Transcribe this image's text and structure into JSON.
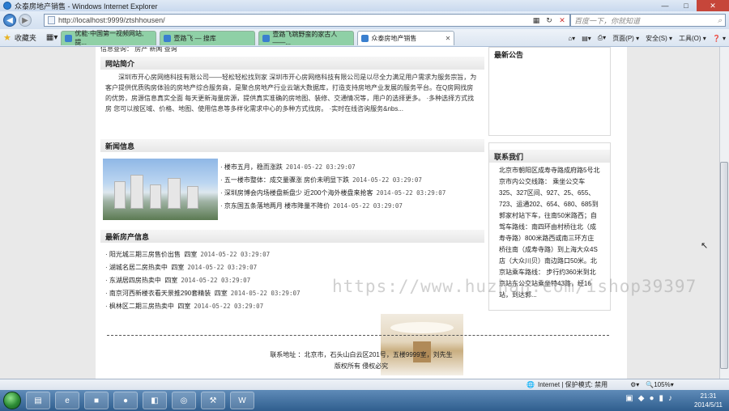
{
  "window": {
    "title": "众泰房地产销售 - Windows Internet Explorer",
    "minimize": "—",
    "maximize": "□",
    "close": "✕"
  },
  "nav": {
    "address": "http://localhost:9999/ztshhousen/",
    "search_placeholder": "百度一下，你就知道",
    "search_icon": "search-icon"
  },
  "favorites": {
    "label": "收藏夹",
    "tabs": [
      {
        "label": "优能·中国第一视频网站,提..."
      },
      {
        "label": "壹路飞 — 搜库"
      },
      {
        "label": "壹路飞跳野蛮的家古人——..."
      },
      {
        "label": "众泰房地产销售"
      }
    ],
    "commands": [
      "页面(P) ▾",
      "安全(S) ▾",
      "工具(O) ▾",
      "❓ ▾"
    ]
  },
  "page": {
    "top_fragment": "信息查询：  房产    新闻                             查询",
    "intro": {
      "heading": "网站简介",
      "text": "深圳市开心房网络科技有限公司——轻松轻松找到家      深圳市开心房网络科技有限公司是以尽全力满足用户需求为服务宗旨，为客户提供优质购房体验的房地产综合服务商，是聚合房地产行业云端大数据库，打造支持房地产业发展的服务平台。在Q房网找房的优势，房源信息真实全面      每天更新海量房源，提供真实准确的房地图、装修、交通情况等，用户的选择更多。 ·多种选择方式找房      您可以按区域、价格、地图、使用信息等多样化需求中心的多种方式找房。 ·实时在线咨询服务&nbs..."
    },
    "news": {
      "heading": "新闻信息",
      "items": [
        {
          "title": "楼市五月，稳而涨跌",
          "date": "2014-05-22 03:29:07"
        },
        {
          "title": "五一楼市整体：成交量骤涨 房价未明显下跌",
          "date": "2014-05-22 03:29:07"
        },
        {
          "title": "深圳房博会内场楼盘新盘少 近200个海外楼盘来抢客",
          "date": "2014-05-22 03:29:07"
        },
        {
          "title": "京东国五条落地两月 楼市降量不降价",
          "date": "2014-05-22 03:29:07"
        }
      ]
    },
    "properties": {
      "heading": "最新房产信息",
      "items": [
        {
          "title": "阳光城三期三房售价出售",
          "type": "四室",
          "date": "2014-05-22 03:29:07"
        },
        {
          "title": "湖城名居二房热卖中",
          "type": "四室",
          "date": "2014-05-22 03:29:07"
        },
        {
          "title": "东湖居四房热卖中",
          "type": "四室",
          "date": "2014-05-22 03:29:07"
        },
        {
          "title": "南京河西新楼衣看天景推290套精装",
          "type": "四室",
          "date": "2014-05-22 03:29:07"
        },
        {
          "title": "枫林区二期三房热卖中",
          "type": "四室",
          "date": "2014-05-22 03:29:07"
        }
      ]
    },
    "notice": {
      "heading": "最新公告"
    },
    "contact": {
      "heading": "联系我们",
      "text": "北京市朝阳区成寿寺路成府路5号北京市内公交线路：    乘坐公交车325、327区间、927、25、655、723、运通202、654、680、685到郭家村站下车，往南50米路西；自驾车路线：南四环由村桥往北（成寿寺路）800米路西或南三环方庄桥往南（成寿寺路）到上海大众4S店（大众川贝）南边路口50米。北京站乘车路线：      步行约360米到北京站东公交站乘坐特43路，经16站，到达郭..."
    },
    "footer": {
      "address": "联系地址 ：北京市，石头山白云区201号，五楼9999室，刘先生",
      "copyright": "版权所有  侵权必究"
    },
    "watermark": "https://www.huzhan.com/ishop39397"
  },
  "status": {
    "zone": "Internet | 保护模式: 禁用",
    "zoom": "105%"
  },
  "taskbar": {
    "time": "21:31",
    "date": "2014/5/11"
  }
}
